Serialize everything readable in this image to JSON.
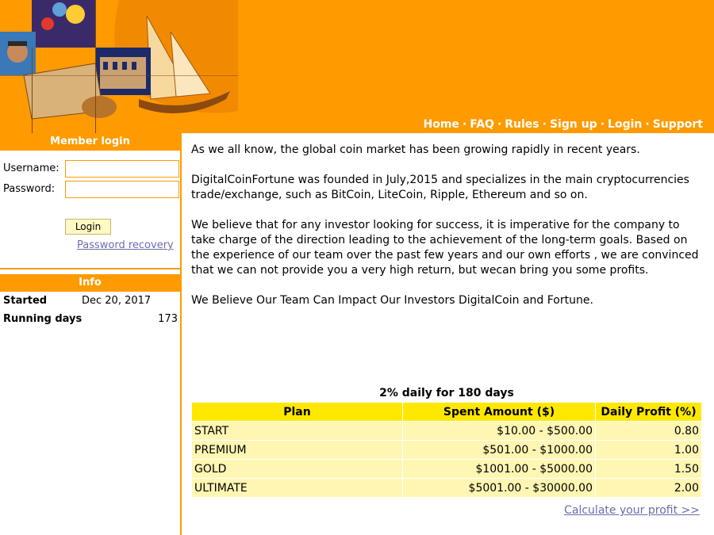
{
  "header": {
    "nav": [
      {
        "label": "Home"
      },
      {
        "label": "FAQ"
      },
      {
        "label": "Rules"
      },
      {
        "label": "Sign up"
      },
      {
        "label": "Login"
      },
      {
        "label": "Support"
      }
    ],
    "separator": "·",
    "brand_color": "#ff9a00"
  },
  "sidebar": {
    "member_login": {
      "title": "Member login",
      "username_label": "Username:",
      "username_value": "",
      "password_label": "Password:",
      "password_value": "",
      "login_button": "Login",
      "recovery_link": "Password recovery"
    },
    "info": {
      "title": "Info",
      "started_label": "Started",
      "started_value": "Dec 20, 2017",
      "running_label": "Running days",
      "running_value": "173"
    }
  },
  "main": {
    "paragraphs": [
      "As we all know, the global coin market has been growing rapidly in recent years.",
      "DigitalCoinFortune was founded in July,2015 and specializes in the main cryptocurrencies trade/exchange, such as BitCoin, LiteCoin, Ripple, Ethereum and so on.",
      "We believe that for any investor looking for success, it is imperative for the company to take charge of the direction leading to the achievement of the long-term goals. Based on the experience of our team over the past few years and our own efforts , we are convinced that we can not provide you a very high return, but wecan bring you some profits.",
      "We Believe Our Team Can Impact Our Investors DigitalCoin and Fortune."
    ],
    "plans": {
      "title": "2% daily for 180 days",
      "headers": [
        "Plan",
        "Spent Amount ($)",
        "Daily Profit (%)"
      ],
      "rows": [
        [
          "START",
          "$10.00 - $500.00",
          "0.80"
        ],
        [
          "PREMIUM",
          "$501.00 - $1000.00",
          "1.00"
        ],
        [
          "GOLD",
          "$1001.00 - $5000.00",
          "1.50"
        ],
        [
          "ULTIMATE",
          "$5001.00 - $30000.00",
          "2.00"
        ]
      ],
      "calc_link": "Calculate your profit >>"
    }
  }
}
